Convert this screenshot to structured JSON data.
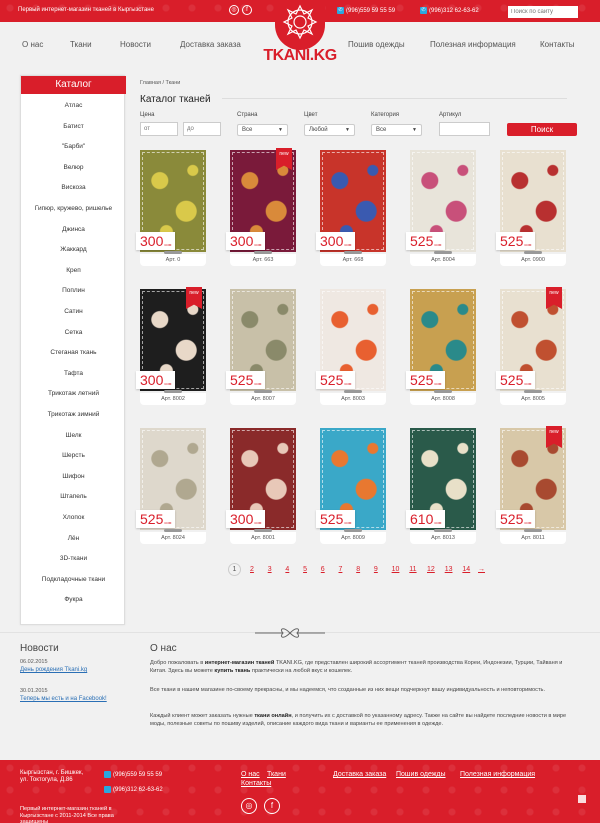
{
  "header": {
    "tagline": "Первый интернет-магазин тканей в Кыргызстане",
    "phones": [
      "(996)559 59 55 59",
      "(996)312 62-63-62"
    ],
    "search_placeholder": "Поиск по сайту",
    "logo_text": "TKANI.KG"
  },
  "nav": {
    "left": [
      "О нас",
      "Ткани",
      "Новости",
      "Доставка заказа"
    ],
    "right": [
      "Пошив одежды",
      "Полезная информация",
      "Контакты"
    ]
  },
  "sidebar": {
    "title": "Каталог",
    "items": [
      "Атлас",
      "Батист",
      "\"Барби\"",
      "Велюр",
      "Вискоза",
      "Гипюр, кружево, ришелье",
      "Джинса",
      "Жаккард",
      "Креп",
      "Поплин",
      "Сатин",
      "Сетка",
      "Стеганая ткань",
      "Тафта",
      "Трикотаж летний",
      "Трикотаж зимний",
      "Шелк",
      "Шерсть",
      "Шифон",
      "Штапель",
      "Хлопок",
      "Лён",
      "3D-ткани",
      "Подкладочные ткани",
      "Фукра"
    ]
  },
  "breadcrumb": {
    "home": "Главная",
    "sep": "/",
    "current": "Ткани"
  },
  "page_title": "Каталог тканей",
  "filters": {
    "price_label": "Цена",
    "price_from": "от",
    "price_to": "до",
    "country_label": "Страна",
    "country_value": "Все",
    "color_label": "Цвет",
    "color_value": "Любой",
    "category_label": "Категория",
    "category_value": "Все",
    "article_label": "Артикул",
    "article_value": "",
    "search_button": "Поиск"
  },
  "currency": "сом",
  "new_badge": "new",
  "products": [
    {
      "price": "300",
      "art": "Арт. 0",
      "isnew": false,
      "bg": "#8a8a3a",
      "pattern": "#d9c94a"
    },
    {
      "price": "300",
      "art": "Арт. 663",
      "isnew": true,
      "bg": "#7a1a3a",
      "pattern": "#d98a3a"
    },
    {
      "price": "300",
      "art": "Арт. 668",
      "isnew": false,
      "bg": "#c8342a",
      "pattern": "#3a5ab0"
    },
    {
      "price": "525",
      "art": "Арт. 8004",
      "isnew": false,
      "bg": "#e8e4da",
      "pattern": "#c8507a"
    },
    {
      "price": "525",
      "art": "Арт. 0900",
      "isnew": false,
      "bg": "#e8e0d0",
      "pattern": "#b83030"
    },
    {
      "price": "300",
      "art": "Арт. 8002",
      "isnew": true,
      "bg": "#1e1e1e",
      "pattern": "#e8d8c8"
    },
    {
      "price": "525",
      "art": "Арт. 8007",
      "isnew": false,
      "bg": "#c8c0a8",
      "pattern": "#8a8a6a"
    },
    {
      "price": "525",
      "art": "Арт. 8003",
      "isnew": false,
      "bg": "#efe8e2",
      "pattern": "#e86030"
    },
    {
      "price": "525",
      "art": "Арт. 8008",
      "isnew": false,
      "bg": "#c8a050",
      "pattern": "#2a8a8a"
    },
    {
      "price": "525",
      "art": "Арт. 8005",
      "isnew": true,
      "bg": "#e8e0d0",
      "pattern": "#c05030"
    },
    {
      "price": "525",
      "art": "Арт. 8024",
      "isnew": false,
      "bg": "#ded8cc",
      "pattern": "#b0a890"
    },
    {
      "price": "300",
      "art": "Арт. 8001",
      "isnew": false,
      "bg": "#8a2a2a",
      "pattern": "#e8c8b8"
    },
    {
      "price": "525",
      "art": "Арт. 8009",
      "isnew": false,
      "bg": "#3aa8c8",
      "pattern": "#e87830"
    },
    {
      "price": "610",
      "art": "Арт. 8013",
      "isnew": false,
      "bg": "#2a5a4a",
      "pattern": "#e8e0c8"
    },
    {
      "price": "525",
      "art": "Арт. 8011",
      "isnew": true,
      "bg": "#d8c8a8",
      "pattern": "#a84a30"
    }
  ],
  "pagination": {
    "current": "1",
    "pages": [
      "2",
      "3",
      "4",
      "5",
      "6",
      "7",
      "8",
      "9",
      "10",
      "11",
      "12",
      "13",
      "14"
    ],
    "next": "→"
  },
  "news": {
    "title": "Новости",
    "items": [
      {
        "date": "06.02.2015",
        "link": "День рождения Tkani.kg"
      },
      {
        "date": "30.01.2015",
        "link": "Теперь мы есть и на Facebook!"
      }
    ]
  },
  "about": {
    "title": "О нас",
    "p1_pre": "Добро пожаловать в ",
    "p1_b1": "интернет-магазин тканей",
    "p1_mid": " TKANI.KG, где представлен широкий ассортимент тканей производства Кореи, Индонезии, Турции, Тайваня и Китая. Здесь вы можете ",
    "p1_b2": "купить ткань",
    "p1_post": " практически на любой вкус и кошелек.",
    "p2": "Все ткани в нашем магазине по-своему прекрасны, и мы надеемся, что созданные из них вещи подчеркнут вашу индивидуальность и неповторимость.",
    "p3_pre": "Каждый клиент может заказать нужные ",
    "p3_b": "ткани онлайн",
    "p3_post": ", и получить их с доставкой по указанному адресу. Также на сайте вы найдете последние новости в мире моды, полезные советы по пошиву изделий, описание каждого вида ткани и варианты ее применения в одежде."
  },
  "footer": {
    "address": "Кыргызстан, г. Бишкек, ул. Токтогула, Д.86",
    "phones": [
      "(996)559 59 55 59",
      "(996)312 62-63-62"
    ],
    "links": [
      "О нас",
      "Ткани",
      "Доставка заказа",
      "Пошив одежды",
      "Полезная информация",
      "Контакты"
    ],
    "copyright": "Первый интернет-магазин тканей в Кыргызстане с 2011-2014 Все права защищены"
  },
  "colors": {
    "brand_red": "#d91e2a",
    "link_blue": "#2a6fb5"
  }
}
